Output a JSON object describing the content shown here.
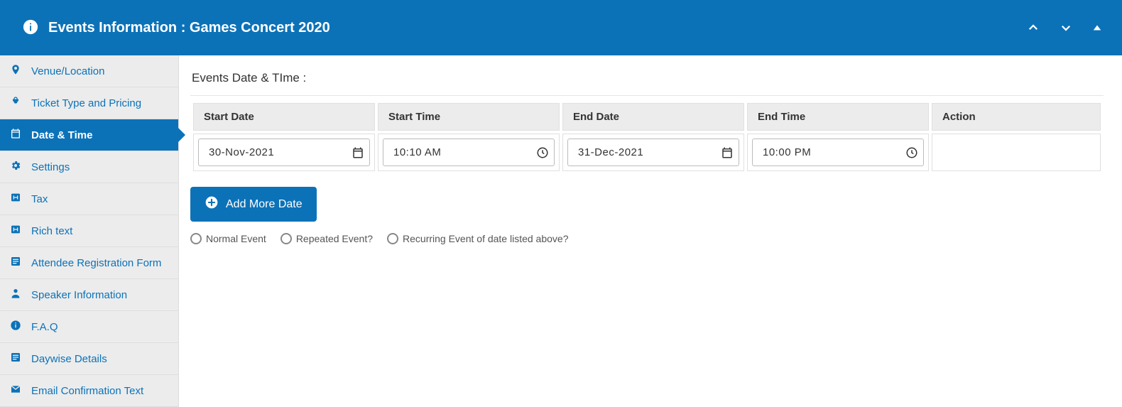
{
  "colors": {
    "primary": "#0C72B8"
  },
  "header": {
    "title": "Events Information : Games Concert 2020"
  },
  "sidebar": {
    "items": [
      {
        "label": "Venue/Location",
        "icon": "pin"
      },
      {
        "label": "Ticket Type and Pricing",
        "icon": "ticket"
      },
      {
        "label": "Date & Time",
        "icon": "calendar",
        "active": true
      },
      {
        "label": "Settings",
        "icon": "gear"
      },
      {
        "label": "Tax",
        "icon": "tax"
      },
      {
        "label": "Rich text",
        "icon": "tax"
      },
      {
        "label": "Attendee Registration Form",
        "icon": "form"
      },
      {
        "label": "Speaker Information",
        "icon": "speaker"
      },
      {
        "label": "F.A.Q",
        "icon": "info"
      },
      {
        "label": "Daywise Details",
        "icon": "form"
      },
      {
        "label": "Email Confirmation Text",
        "icon": "mail"
      }
    ]
  },
  "main": {
    "section_title": "Events Date & TIme :",
    "columns": {
      "start_date": "Start Date",
      "start_time": "Start Time",
      "end_date": "End Date",
      "end_time": "End Time",
      "action": "Action"
    },
    "rows": [
      {
        "start_date": "30-Nov-2021",
        "start_time": "10:10 AM",
        "end_date": "31-Dec-2021",
        "end_time": "10:00 PM"
      }
    ],
    "add_more_label": "Add More Date",
    "event_type_options": {
      "normal": "Normal Event",
      "repeated": "Repeated Event?",
      "recurring": "Recurring Event of date listed above?"
    }
  }
}
